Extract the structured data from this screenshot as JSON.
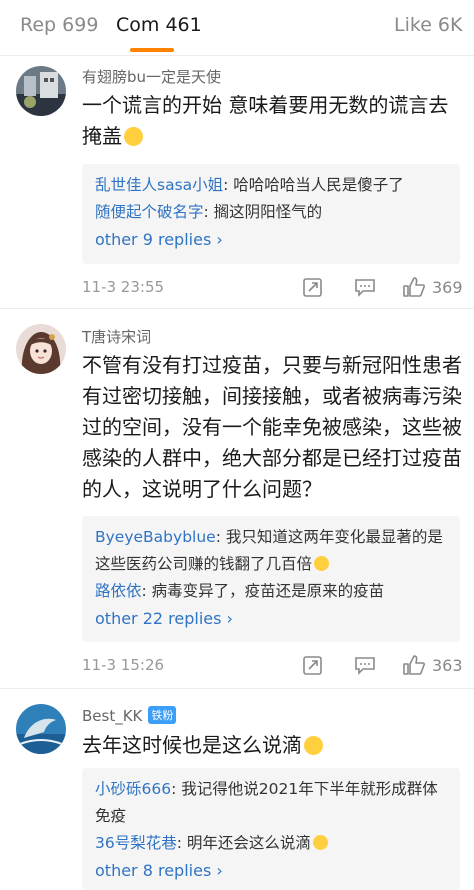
{
  "tabs": [
    {
      "label": "Rep 699"
    },
    {
      "label": "Com 461"
    },
    {
      "label": "Like 6K"
    }
  ],
  "comments": [
    {
      "username": "有翅膀bu一定是天使",
      "content": "一个谎言的开始 意味着要用无数的谎言去掩盖",
      "replies": [
        {
          "name": "乱世佳人sasa小姐",
          "text": ": 哈哈哈哈当人民是傻子了"
        },
        {
          "name": "随便起个破名字",
          "text": ": 搁这阴阳怪气的"
        }
      ],
      "more": "other 9 replies ›",
      "time": "11-3 23:55",
      "likes": "369"
    },
    {
      "username": "T唐诗宋词",
      "content": "不管有没有打过疫苗，只要与新冠阳性患者有过密切接触，间接接触，或者被病毒污染过的空间，没有一个能幸免被感染，这些被感染的人群中，绝大部分都是已经打过疫苗的人，这说明了什么问题？",
      "replies": [
        {
          "name": "ByeyeBabyblue",
          "text": ": 我只知道这两年变化最显著的是这些医药公司赚的钱翻了几百倍"
        },
        {
          "name": "路依依",
          "text": ": 病毒变异了，疫苗还是原来的疫苗"
        }
      ],
      "more": "other 22 replies ›",
      "time": "11-3 15:26",
      "likes": "363"
    },
    {
      "username": "Best_KK",
      "badge": "铁粉",
      "content": "去年这时候也是这么说滴",
      "replies": [
        {
          "name": "小砂砾666",
          "text": ": 我记得他说2021年下半年就形成群体免疫"
        },
        {
          "name": "36号梨花巷",
          "text": ": 明年还会这么说滴"
        }
      ],
      "more": "other 8 replies ›"
    }
  ],
  "colors": {
    "accent": "#ff8200",
    "link": "#2f74c4",
    "badge": "#3b9ef7"
  },
  "icons": [
    "repost-icon",
    "comment-icon",
    "thumbs-up-icon",
    "chevron-right-icon"
  ]
}
